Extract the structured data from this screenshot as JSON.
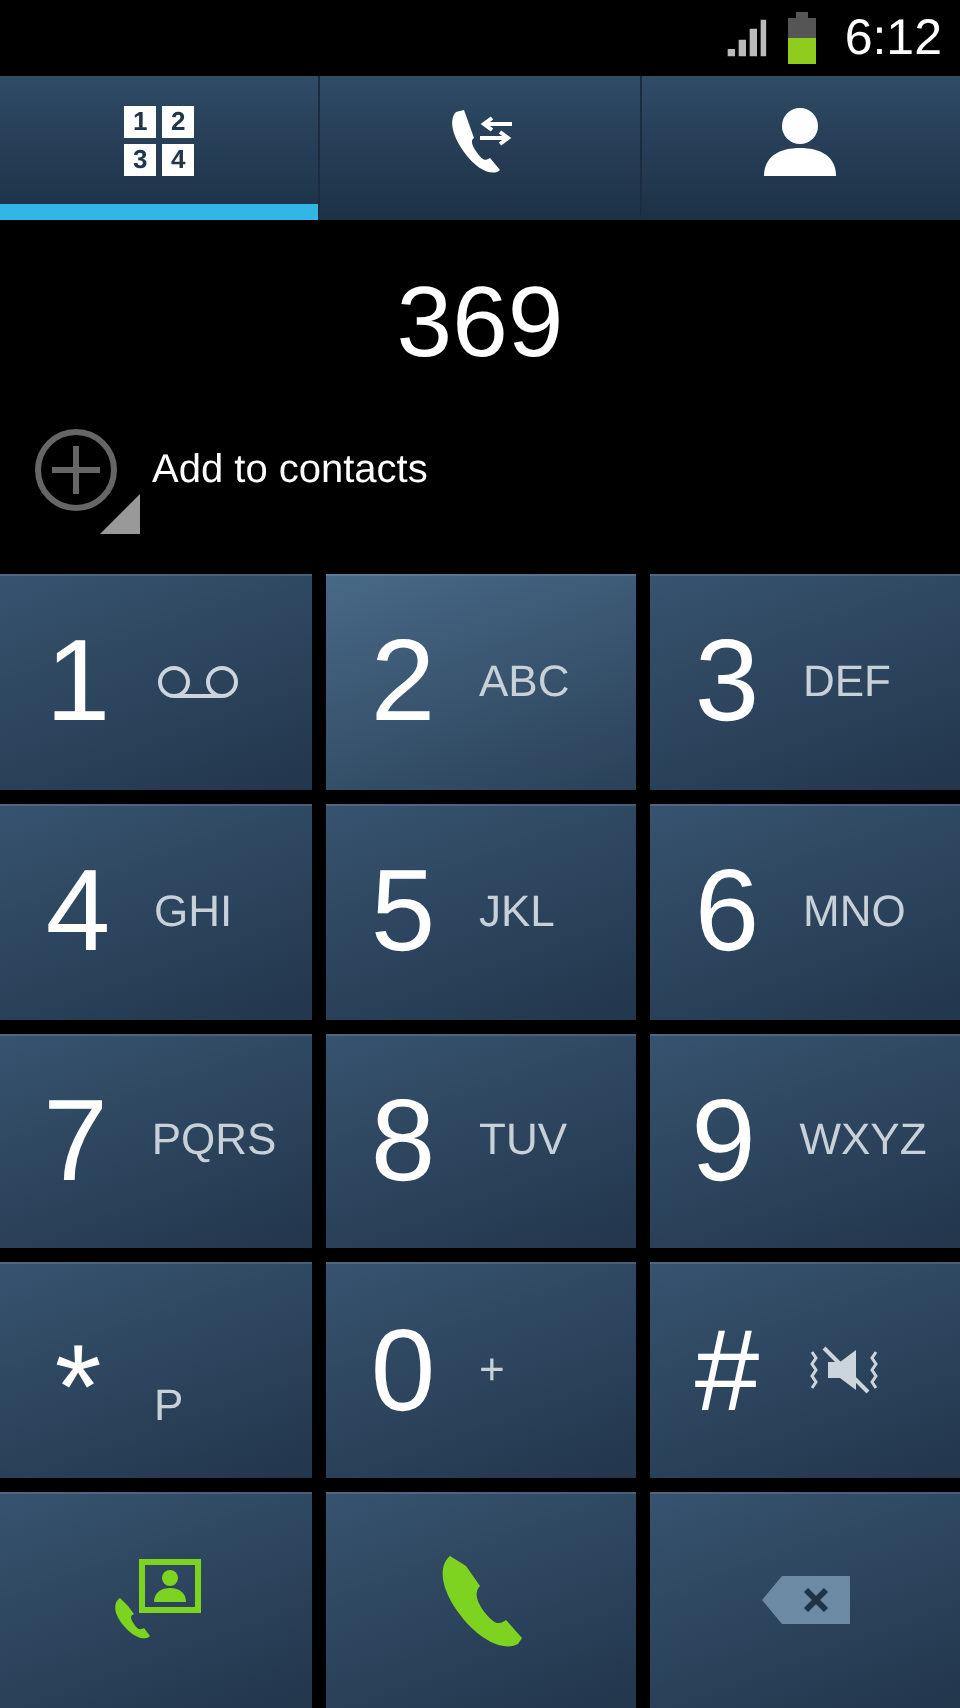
{
  "status_bar": {
    "time": "6:12"
  },
  "tabs": [
    {
      "kind": "dialpad",
      "glyphs": [
        "1",
        "2",
        "3",
        "4"
      ],
      "selected": true
    },
    {
      "kind": "logs",
      "selected": false
    },
    {
      "kind": "contacts",
      "selected": false
    }
  ],
  "number": "369",
  "add_to_contacts": "Add to contacts",
  "keys": [
    {
      "digit": "1",
      "kind": "voicemail"
    },
    {
      "digit": "2",
      "kind": "letters",
      "letters": "ABC"
    },
    {
      "digit": "3",
      "kind": "letters",
      "letters": "DEF"
    },
    {
      "digit": "4",
      "kind": "letters",
      "letters": "GHI"
    },
    {
      "digit": "5",
      "kind": "letters",
      "letters": "JKL"
    },
    {
      "digit": "6",
      "kind": "letters",
      "letters": "MNO"
    },
    {
      "digit": "7",
      "kind": "letters",
      "letters": "PQRS"
    },
    {
      "digit": "8",
      "kind": "letters",
      "letters": "TUV"
    },
    {
      "digit": "9",
      "kind": "letters",
      "letters": "WXYZ"
    },
    {
      "digit": "*",
      "kind": "star",
      "letters": "P"
    },
    {
      "digit": "0",
      "kind": "letters",
      "letters": "+"
    },
    {
      "digit": "#",
      "kind": "mute"
    }
  ],
  "actions": [
    {
      "kind": "video_call"
    },
    {
      "kind": "call"
    },
    {
      "kind": "backspace"
    }
  ]
}
